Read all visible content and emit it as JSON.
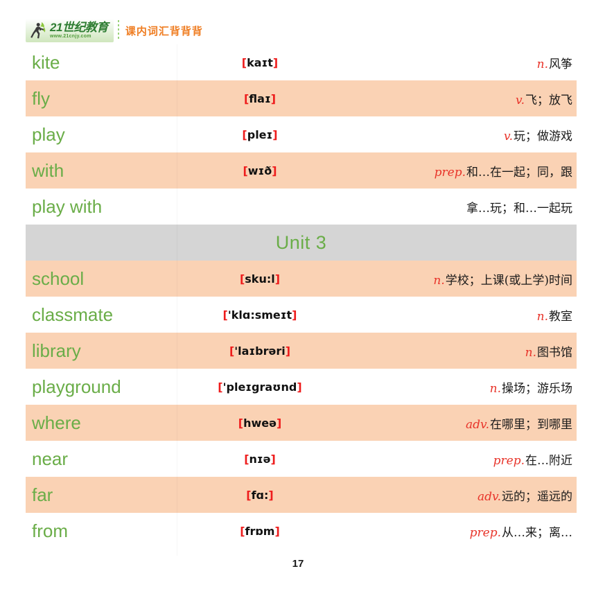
{
  "header": {
    "logo_main": "21世纪教育",
    "logo_url": "www.21cnjy.com",
    "tagline": "课内词汇背背背",
    "logo_icon": "running-person-icon"
  },
  "colors": {
    "word_green": "#6aad48",
    "row_peach": "#fad2b4",
    "unit_gray": "#d5d5d5",
    "pos_red": "#e8342a",
    "bracket_red": "#ee1c1c",
    "tagline_orange": "#ef7d22"
  },
  "table": {
    "rows": [
      {
        "type": "entry",
        "word": "kite",
        "ipa_open": "[",
        "ipa": "kaɪt",
        "ipa_close": "]",
        "pos": "n.",
        "definition": "风筝",
        "shaded": false
      },
      {
        "type": "entry",
        "word": "fly",
        "ipa_open": "[",
        "ipa": "flaɪ",
        "ipa_close": "]",
        "pos": "v.",
        "definition": "飞；放飞",
        "shaded": true
      },
      {
        "type": "entry",
        "word": "play",
        "ipa_open": "[",
        "ipa": "pleɪ",
        "ipa_close": "]",
        "pos": "v.",
        "definition": "玩；做游戏",
        "shaded": false
      },
      {
        "type": "entry",
        "word": "with",
        "ipa_open": "[",
        "ipa": "wɪð",
        "ipa_close": "]",
        "pos": "prep.",
        "definition": "和…在一起；同，跟",
        "shaded": true
      },
      {
        "type": "entry",
        "word": "play with",
        "ipa_open": "",
        "ipa": "",
        "ipa_close": "",
        "pos": "",
        "definition": "拿…玩；和…一起玩",
        "shaded": false
      },
      {
        "type": "unit",
        "label": "Unit 3"
      },
      {
        "type": "entry",
        "word": "school",
        "ipa_open": "[",
        "ipa": "sku:l",
        "ipa_close": "]",
        "pos": "n.",
        "definition": "学校；上课(或上学)时间",
        "shaded": true
      },
      {
        "type": "entry",
        "word": "classmate",
        "ipa_open": "[",
        "ipa": "'klɑ:smeɪt",
        "ipa_close": "]",
        "pos": "n.",
        "definition": "教室",
        "shaded": false
      },
      {
        "type": "entry",
        "word": "library",
        "ipa_open": "[",
        "ipa": "'laɪbrəri",
        "ipa_close": "]",
        "pos": "n.",
        "definition": "图书馆",
        "shaded": true
      },
      {
        "type": "entry",
        "word": "playground",
        "ipa_open": "[",
        "ipa": "'pleɪgraʊnd",
        "ipa_close": "]",
        "pos": "n.",
        "definition": "操场；游乐场",
        "shaded": false
      },
      {
        "type": "entry",
        "word": "where",
        "ipa_open": "[",
        "ipa": "hweə",
        "ipa_close": "]",
        "pos": "adv.",
        "definition": "在哪里；到哪里",
        "shaded": true
      },
      {
        "type": "entry",
        "word": "near",
        "ipa_open": "[",
        "ipa": "nɪə",
        "ipa_close": "]",
        "pos": "prep.",
        "definition": "在…附近",
        "shaded": false
      },
      {
        "type": "entry",
        "word": "far",
        "ipa_open": "[",
        "ipa": "fɑ:",
        "ipa_close": "]",
        "pos": "adv.",
        "definition": "远的；遥远的",
        "shaded": true
      },
      {
        "type": "entry",
        "word": "from",
        "ipa_open": "[",
        "ipa": "frɒm",
        "ipa_close": "]",
        "pos": "prep.",
        "definition": "从…来；离…",
        "shaded": false
      }
    ]
  },
  "footer": {
    "page_number": "17"
  }
}
